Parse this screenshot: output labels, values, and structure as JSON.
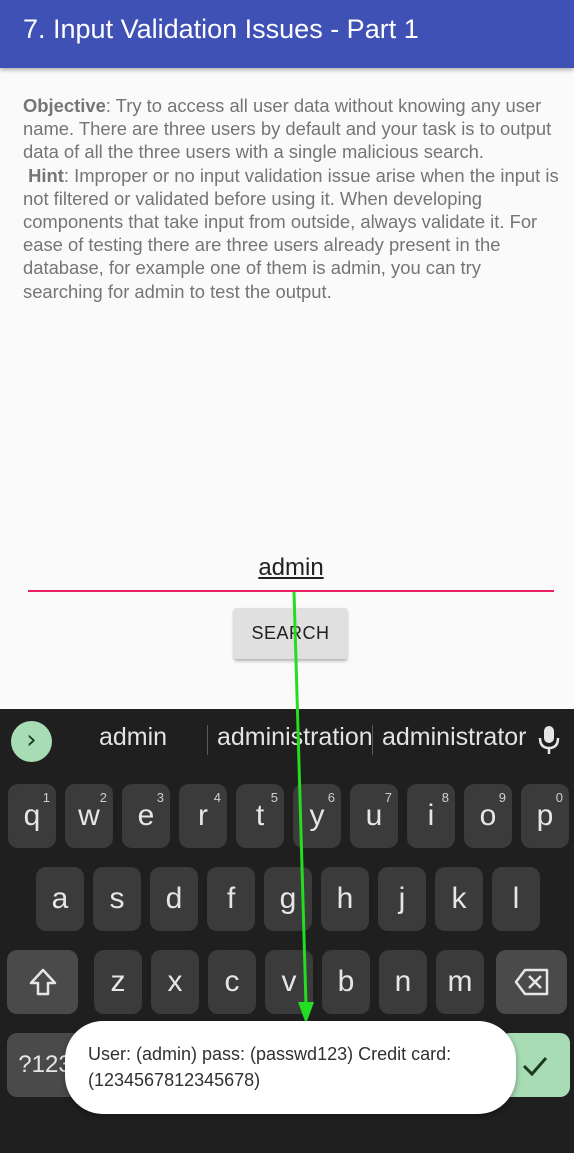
{
  "appbar": {
    "title": "7. Input Validation Issues - Part 1"
  },
  "description": {
    "objective_label": "Objective",
    "objective_text": ": Try to access all user data without knowing any user name. There are three users by default and your task is to output data of all the three users with a single malicious search.",
    "hint_label": "Hint",
    "hint_text": ": Improper or no input validation issue arise when the input is not filtered or validated before using it. When developing components that take input from outside, always validate it. For ease of testing there are three users already present in the database, for example one of them is admin, you can try searching for admin to test the output."
  },
  "input": {
    "value": "admin"
  },
  "search_button": {
    "label": "SEARCH"
  },
  "keyboard": {
    "suggestions": [
      "admin",
      "administration",
      "administrator"
    ],
    "row1": [
      {
        "k": "q",
        "h": "1"
      },
      {
        "k": "w",
        "h": "2"
      },
      {
        "k": "e",
        "h": "3"
      },
      {
        "k": "r",
        "h": "4"
      },
      {
        "k": "t",
        "h": "5"
      },
      {
        "k": "y",
        "h": "6"
      },
      {
        "k": "u",
        "h": "7"
      },
      {
        "k": "i",
        "h": "8"
      },
      {
        "k": "o",
        "h": "9"
      },
      {
        "k": "p",
        "h": "0"
      }
    ],
    "row2": [
      "a",
      "s",
      "d",
      "f",
      "g",
      "h",
      "j",
      "k",
      "l"
    ],
    "row3": [
      "z",
      "x",
      "c",
      "v",
      "b",
      "n",
      "m"
    ],
    "num_key": "?123",
    "icons": {
      "suggestion_expand": "chevron-right-icon",
      "mic": "microphone-icon",
      "shift": "shift-icon",
      "backspace": "backspace-icon",
      "enter": "checkmark-icon"
    }
  },
  "toast": {
    "text": "User: (admin) pass: (passwd123) Credit card: (1234567812345678)"
  },
  "colors": {
    "appbar": "#3f51b5",
    "underline": "#e91e63",
    "keyboard_bg": "#1f1f1f",
    "accent_key": "#a8dcb4",
    "arrow": "#22dd22"
  }
}
